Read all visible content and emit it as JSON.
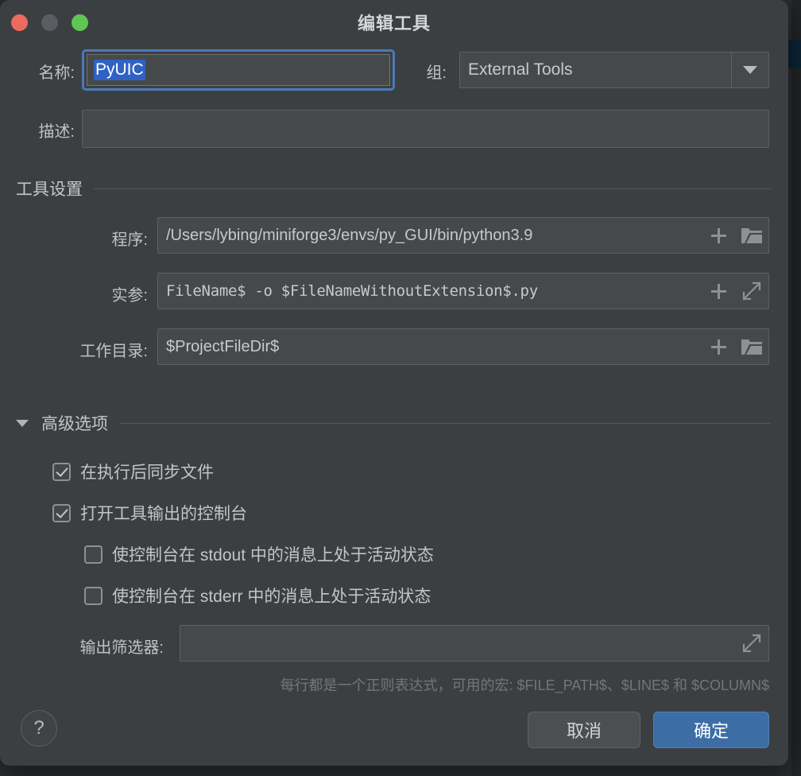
{
  "window": {
    "title": "编辑工具",
    "traffic_lights": [
      "close",
      "minimize",
      "zoom"
    ]
  },
  "form": {
    "name_label": "名称:",
    "name_value": "PyUIC",
    "group_label": "组:",
    "group_value": "External Tools",
    "description_label": "描述:",
    "description_value": ""
  },
  "tool_settings": {
    "section_title": "工具设置",
    "program_label": "程序:",
    "program_value": "/Users/lybing/miniforge3/envs/py_GUI/bin/python3.9",
    "arguments_label": "实参:",
    "arguments_value": "FileName$ -o $FileNameWithoutExtension$.py",
    "working_dir_label": "工作目录:",
    "working_dir_value": "$ProjectFileDir$"
  },
  "advanced": {
    "section_title": "高级选项",
    "checkboxes": [
      {
        "label": "在执行后同步文件",
        "checked": true
      },
      {
        "label": "打开工具输出的控制台",
        "checked": true
      },
      {
        "label": "使控制台在 stdout 中的消息上处于活动状态",
        "checked": false
      },
      {
        "label": "使控制台在 stderr 中的消息上处于活动状态",
        "checked": false
      }
    ],
    "output_filter_label": "输出筛选器:",
    "output_filter_value": "",
    "hint": "每行都是一个正则表达式，可用的宏: $FILE_PATH$、$LINE$ 和 $COLUMN$"
  },
  "footer": {
    "help_label": "?",
    "cancel_label": "取消",
    "ok_label": "确定"
  },
  "colors": {
    "dialog_bg": "#3c3f41",
    "field_bg": "#45494a",
    "accent_blue": "#3c6ea5",
    "focus_ring": "#4a7ab5",
    "selection_blue": "#2f62c4",
    "traffic_red": "#ec6a5e",
    "traffic_yellow": "#5a5e62",
    "traffic_green": "#61c554"
  }
}
